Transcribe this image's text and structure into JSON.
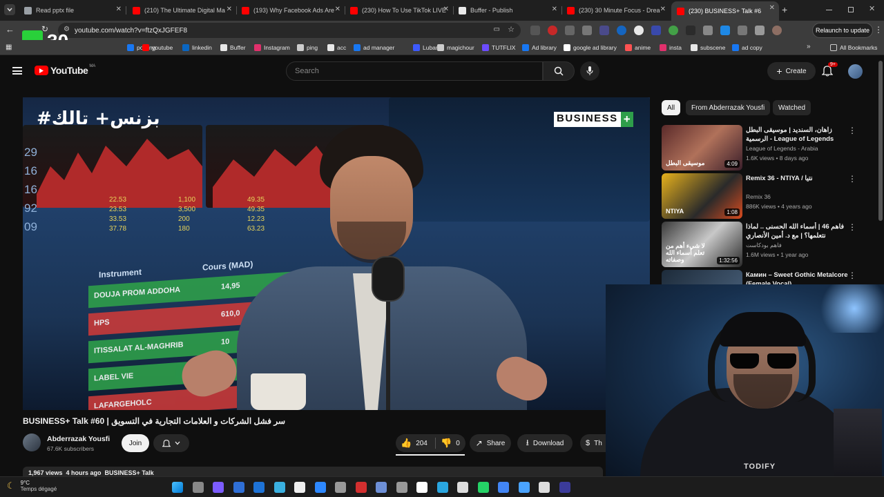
{
  "browser": {
    "tabs": [
      {
        "title": "Read pptx file",
        "color": "#9aa0a6"
      },
      {
        "title": "(210) The Ultimate Digital Ma",
        "color": "#ff0000"
      },
      {
        "title": "(193) Why Facebook Ads Are",
        "color": "#ff0000"
      },
      {
        "title": "(230) How To Use TikTok LIVE",
        "color": "#ff0000"
      },
      {
        "title": "Buffer - Publish",
        "color": "#e8e8e8"
      },
      {
        "title": "(230) 30 Minute Focus - Drea",
        "color": "#ff0000"
      },
      {
        "title": "(230) BUSINESS+ Talk #6",
        "color": "#ff0000"
      }
    ],
    "new_tab": "+",
    "url": "youtube.com/watch?v=ftzQxJGFEF8",
    "relaunch_label": "Relaunch to update",
    "overlay_text": "30",
    "bookmarks": [
      {
        "label": "posting",
        "color": "#1877f2"
      },
      {
        "label": "youtube",
        "color": "#ff0000"
      },
      {
        "label": "linkedin",
        "color": "#0a66c2"
      },
      {
        "label": "Buffer",
        "color": "#e8e8e8"
      },
      {
        "label": "Instagram",
        "color": "#e1306c"
      },
      {
        "label": "ping",
        "color": "#cccccc"
      },
      {
        "label": "acc",
        "color": "#e8e8e8"
      },
      {
        "label": "ad manager",
        "color": "#1877f2"
      },
      {
        "label": "Luban",
        "color": "#3d5afe"
      },
      {
        "label": "magichour",
        "color": "#cccccc"
      },
      {
        "label": "TUTFLIX",
        "color": "#6c4cff"
      },
      {
        "label": "Ad library",
        "color": "#1877f2"
      },
      {
        "label": "google ad library",
        "color": "#ffffff"
      },
      {
        "label": "anime",
        "color": "#ff5252"
      },
      {
        "label": "insta",
        "color": "#e1306c"
      },
      {
        "label": "subscene",
        "color": "#e8e8e8"
      },
      {
        "label": "ad copy",
        "color": "#1877f2"
      }
    ],
    "all_bookmarks": "All Bookmarks"
  },
  "youtube": {
    "logo_text": "YouTube",
    "country_code": "MA",
    "search_placeholder": "Search",
    "create_label": "Create",
    "notif_badge": "9+",
    "video": {
      "title": "BUSINESS+ Talk #60 | سر فشل الشركات و العلامات التجارية في التسويق",
      "overlay_hashtag": "#بزنس+ تالك",
      "overlay_brand": "BUSINESS",
      "overlay_brand_plus": "+",
      "board_header_instrument": "Instrument",
      "board_header_cours": "Cours (MAD)",
      "board_rows": [
        {
          "name": "DOUJA PROM ADDOHA",
          "value": "14,95",
          "color": "#2e9e4a"
        },
        {
          "name": "HPS",
          "value": "610,0",
          "color": "#c83a3a"
        },
        {
          "name": "ITISSALAT AL-MAGHRIB",
          "value": "10",
          "color": "#2e9e4a"
        },
        {
          "name": "LABEL VIE",
          "value": "",
          "color": "#2e9e4a"
        },
        {
          "name": "LAFARGEHOLC",
          "value": "",
          "color": "#c83a3a"
        }
      ],
      "ticker_values": [
        "22.53",
        "1,100",
        "49.35",
        "23.53",
        "3,500",
        "49.35",
        "33.53",
        "200",
        "12.23",
        "37.78",
        "180",
        "63.23"
      ],
      "left_scale": [
        "29",
        "16",
        "16",
        "92",
        "09"
      ]
    },
    "channel": {
      "name": "Abderrazak Yousfi",
      "subscribers": "67.6K subscribers",
      "join_label": "Join"
    },
    "actions": {
      "likes": "204",
      "dislikes": "0",
      "share": "Share",
      "download": "Download",
      "thanks": "Th"
    },
    "meta_line": "1,967 views  4 hours ago  BUSINESS+ Talk",
    "filters": [
      "All",
      "From Abderrazak Yousfi",
      "Watched"
    ],
    "recommendations": [
      {
        "title": "زاهان، السندید | موسیقی البطل الرسمية - League of Legends",
        "channel": "League of Legends - Arabia",
        "meta": "1.6K views • 8 days ago",
        "duration": "4:09",
        "thumb_text": "موسيقى البطل"
      },
      {
        "title": "Remix 36 - NTIYA / نتيا",
        "channel": "Remix 36",
        "meta": "886K views • 4 years ago",
        "duration": "1:08",
        "thumb_text": "NTIYA"
      },
      {
        "title": "فاهم 46 | أسماء الله الحسنى .. لماذا نتعلمها؟ | مع د. أمين الأنصاري",
        "channel": "فاهم بودكاست",
        "meta": "1.6M views • 1 year ago",
        "duration": "1:32:56",
        "thumb_text": "لا شيء أهم من تعلم أسماء الله وصفاته"
      },
      {
        "title": "Камин – Sweet Gothic Metalcore (Female Vocal)",
        "channel": "",
        "meta": "",
        "duration": "",
        "thumb_text": "Камин"
      }
    ]
  },
  "webcam": {
    "shirt_text": "TODIFY"
  },
  "taskbar": {
    "temperature": "9°C",
    "weather": "Temps dégagé"
  }
}
